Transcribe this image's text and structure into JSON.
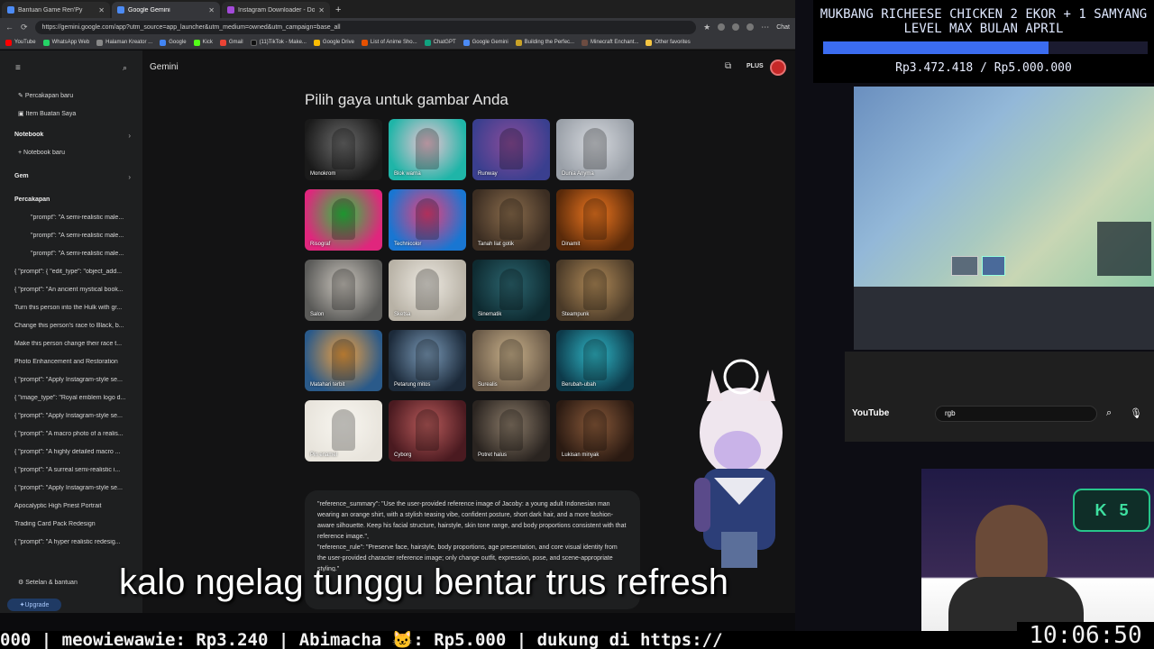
{
  "browser": {
    "tabs": [
      {
        "label": "Bantuan Game Ren'Py"
      },
      {
        "label": "Google Gemini"
      },
      {
        "label": "Instagram Downloader - Downlo..."
      }
    ],
    "url": "https://gemini.google.com/app?utm_source=app_launcher&utm_medium=owned&utm_campaign=base_all",
    "bookmarks": [
      "YouTube",
      "WhatsApp Web",
      "Halaman Kreator ...",
      "Google",
      "Kick",
      "Gmail",
      "(11)TikTok - Make...",
      "Google Drive",
      "List of Anime Sho...",
      "ChatGPT",
      "Google Gemini",
      "Building the Perfec...",
      "Minecraft Enchant...",
      "Other favorites"
    ],
    "chat_label": "Chat"
  },
  "sidebar": {
    "new_chat": "Percakapan baru",
    "my_items": "Item Buatan Saya",
    "notebook_header": "Notebook",
    "new_notebook": "Notebook baru",
    "gem_header": "Gem",
    "chats_header": "Percakapan",
    "chats": [
      "\"prompt\": \"A semi-realistic male...",
      "\"prompt\": \"A semi-realistic male...",
      "\"prompt\": \"A semi-realistic male...",
      "{ \"prompt\": { \"edit_type\": \"object_add...",
      "{ \"prompt\": \"An ancient mystical book...",
      "Turn this person into the Hulk with gr...",
      "Change this person's race to Black, b...",
      "Make this person change their race t...",
      "Photo Enhancement and Restoration",
      "{ \"prompt\": \"Apply Instagram-style se...",
      "{ \"image_type\": \"Royal emblem logo d...",
      "{ \"prompt\": \"Apply Instagram-style se...",
      "{ \"prompt\": \"A macro photo of a realis...",
      "{ \"prompt\": \"A highly detailed macro ...",
      "{ \"prompt\": \"A surreal semi-realistic i...",
      "{ \"prompt\": \"Apply Instagram-style se...",
      "Apocalyptic High Priest Portrait",
      "Trading Card Pack Redesign",
      "{ \"prompt\": \"A hyper realistic redesig..."
    ],
    "settings": "Setelan & bantuan",
    "upgrade": "Upgrade"
  },
  "main": {
    "app_name": "Gemini",
    "plan": "PLUS",
    "heading": "Pilih gaya untuk gambar Anda",
    "styles": [
      {
        "label": "Monokrom",
        "c1": "#1a1a1a",
        "c2": "#6b6b6b"
      },
      {
        "label": "Blok warna",
        "c1": "#1fb5a8",
        "c2": "#f2c4d3"
      },
      {
        "label": "Runway",
        "c1": "#3a3f8f",
        "c2": "#8a4c9a"
      },
      {
        "label": "Dunia Anyma",
        "c1": "#9aa0a8",
        "c2": "#d6d9de"
      },
      {
        "label": "Risograf",
        "c1": "#e0267d",
        "c2": "#28c840"
      },
      {
        "label": "Technicolor",
        "c1": "#1976d2",
        "c2": "#ec407a"
      },
      {
        "label": "Tanah liat gotik",
        "c1": "#3b2d22",
        "c2": "#8a6c4c"
      },
      {
        "label": "Dinamit",
        "c1": "#5a2a0a",
        "c2": "#f07820"
      },
      {
        "label": "Salon",
        "c1": "#5a5a58",
        "c2": "#c9c4bc"
      },
      {
        "label": "Sketsa",
        "c1": "#b8b2a6",
        "c2": "#eeeae2"
      },
      {
        "label": "Sinematik",
        "c1": "#0e2a30",
        "c2": "#2c6670"
      },
      {
        "label": "Steampunk",
        "c1": "#4a3a28",
        "c2": "#b08a58"
      },
      {
        "label": "Matahari terbit",
        "c1": "#2a5a8a",
        "c2": "#f0a040"
      },
      {
        "label": "Petarung mitos",
        "c1": "#1c2a3a",
        "c2": "#7a9ab8"
      },
      {
        "label": "Surealis",
        "c1": "#6a5a48",
        "c2": "#c8b08a"
      },
      {
        "label": "Berubah-ubah",
        "c1": "#0d3a4a",
        "c2": "#30b8c8"
      },
      {
        "label": "Pin enamel",
        "c1": "#e8e4dc",
        "c2": "#f8f6f0"
      },
      {
        "label": "Cyborg",
        "c1": "#4a1a20",
        "c2": "#b85a5a"
      },
      {
        "label": "Potret halus",
        "c1": "#2a2420",
        "c2": "#8a7a68"
      },
      {
        "label": "Lukisan minyak",
        "c1": "#2a1a12",
        "c2": "#8a5a3a"
      }
    ],
    "prompt_text": "\"reference_summary\": \"Use the user-provided reference image of Jacoby: a young adult Indonesian man wearing an orange shirt, with a stylish teasing vibe, confident posture, short dark hair, and a more fashion-aware silhouette. Keep his facial structure, hairstyle, skin tone range, and body proportions consistent with that reference image.\",\n\"reference_rule\": \"Preserve face, hairstyle, body proportions, age presentation, and core visual identity from the user-provided character reference image; only change outfit, expression, pose, and scene-appropriate styling.\""
  },
  "overlay": {
    "donation_title": "MUKBANG RICHEESE CHICKEN 2 EKOR + 1 SAMYANG LEVEL MAX BULAN APRIL",
    "donation_amount": "Rp3.472.418 / Rp5.000.000",
    "donation_progress": 0.694,
    "yt_search": "rgb",
    "yt_logo": "YouTube",
    "k_badge_letter": "K",
    "k_badge_count": "5",
    "clock": "10:06:50",
    "subtitle": "kalo ngelag tunggu bentar trus refresh",
    "ticker": "000 | meowiewawie: Rp3.240 | Abimacha 🐱: Rp5.000 |  dukung di https://"
  }
}
